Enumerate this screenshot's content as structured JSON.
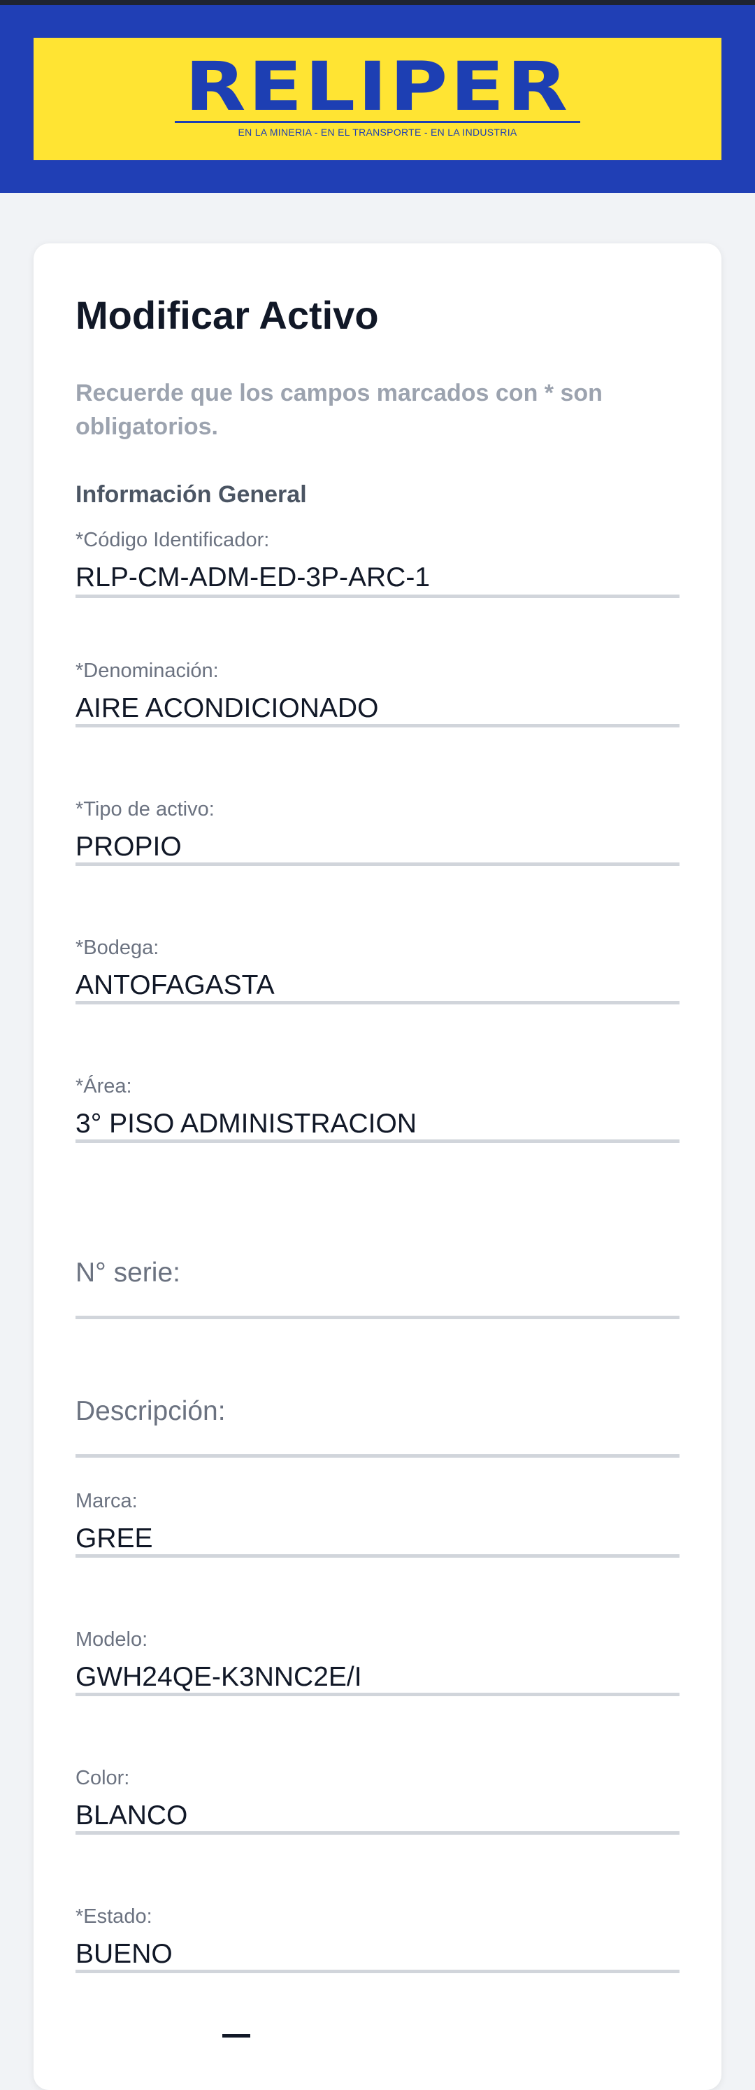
{
  "header": {
    "logo_name": "RELIPER",
    "logo_tagline": "EN LA MINERIA - EN EL TRANSPORTE - EN LA INDUSTRIA",
    "brand_yellow": "#ffe433",
    "brand_blue": "#203fb5"
  },
  "form": {
    "title": "Modificar Activo",
    "note": "Recuerde que los campos marcados con * son obligatorios.",
    "section": "Información General",
    "fields": [
      {
        "label": "*Código Identificador:",
        "value": "RLP-CM-ADM-ED-3P-ARC-1"
      },
      {
        "label": "*Denominación:",
        "value": "AIRE ACONDICIONADO"
      },
      {
        "label": "*Tipo de activo:",
        "value": "PROPIO"
      },
      {
        "label": "*Bodega:",
        "value": "ANTOFAGASTA"
      },
      {
        "label": "*Área:",
        "value": "3° PISO ADMINISTRACION"
      },
      {
        "placeholder": "N° serie:"
      },
      {
        "placeholder": "Descripción:"
      },
      {
        "label": "Marca:",
        "value": "GREE"
      },
      {
        "label": "Modelo:",
        "value": "GWH24QE-K3NNC2E/I"
      },
      {
        "label": "Color:",
        "value": "BLANCO"
      },
      {
        "label": "*Estado:",
        "value": "BUENO"
      }
    ]
  }
}
